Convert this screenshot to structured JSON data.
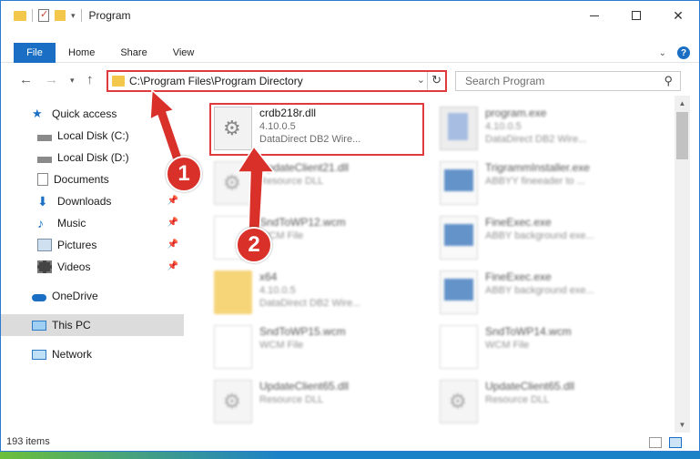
{
  "window": {
    "title": "Program"
  },
  "ribbon": {
    "tabs": [
      "File",
      "Home",
      "Share",
      "View"
    ]
  },
  "address": {
    "path": "C:\\Program Files\\Program Directory",
    "search_placeholder": "Search Program"
  },
  "nav": {
    "items": [
      {
        "label": "Quick access",
        "icon": "star-icon"
      },
      {
        "label": "Local Disk (C:)",
        "icon": "drive-icon"
      },
      {
        "label": "Local Disk (D:)",
        "icon": "drive-icon"
      },
      {
        "label": "Documents",
        "icon": "documents-icon"
      },
      {
        "label": "Downloads",
        "icon": "download-icon"
      },
      {
        "label": "Music",
        "icon": "music-icon"
      },
      {
        "label": "Pictures",
        "icon": "pictures-icon"
      },
      {
        "label": "Videos",
        "icon": "videos-icon"
      },
      {
        "label": "OneDrive",
        "icon": "cloud-icon"
      },
      {
        "label": "This PC",
        "icon": "computer-icon"
      },
      {
        "label": "Network",
        "icon": "network-icon"
      }
    ]
  },
  "files": {
    "left": [
      {
        "name": "crdb218r.dll",
        "line1": "4.10.0.5",
        "line2": "DataDirect DB2 Wire...",
        "kind": "dll"
      },
      {
        "name": "UpdateClient21.dll",
        "line1": "Resource DLL",
        "line2": "",
        "kind": "dll"
      },
      {
        "name": "SndToWP12.wcm",
        "line1": "WCM File",
        "line2": "",
        "kind": "doc"
      },
      {
        "name": "x64",
        "line1": "4.10.0.5",
        "line2": "DataDirect DB2 Wire...",
        "kind": "folder"
      },
      {
        "name": "SndToWP15.wcm",
        "line1": "WCM File",
        "line2": "",
        "kind": "doc"
      },
      {
        "name": "UpdateClient65.dll",
        "line1": "Resource DLL",
        "line2": "",
        "kind": "dll"
      }
    ],
    "right": [
      {
        "name": "program.exe",
        "line1": "4.10.0.5",
        "line2": "DataDirect DB2 Wire...",
        "kind": "exe"
      },
      {
        "name": "TrigrammInstaller.exe",
        "line1": "ABBYY fineeader to ...",
        "line2": "",
        "kind": "app"
      },
      {
        "name": "FineExec.exe",
        "line1": "ABBY background exe...",
        "line2": "",
        "kind": "app"
      },
      {
        "name": "FineExec.exe",
        "line1": "ABBY background exe...",
        "line2": "",
        "kind": "app"
      },
      {
        "name": "SndToWP14.wcm",
        "line1": "WCM File",
        "line2": "",
        "kind": "doc"
      },
      {
        "name": "UpdateClient65.dll",
        "line1": "Resource DLL",
        "line2": "",
        "kind": "dll"
      }
    ]
  },
  "status": {
    "count": "193 items"
  },
  "annotations": {
    "step1": "1",
    "step2": "2"
  },
  "colors": {
    "accent": "#1a6fc4",
    "highlight": "#e03a3a",
    "badge": "#d9302a"
  }
}
